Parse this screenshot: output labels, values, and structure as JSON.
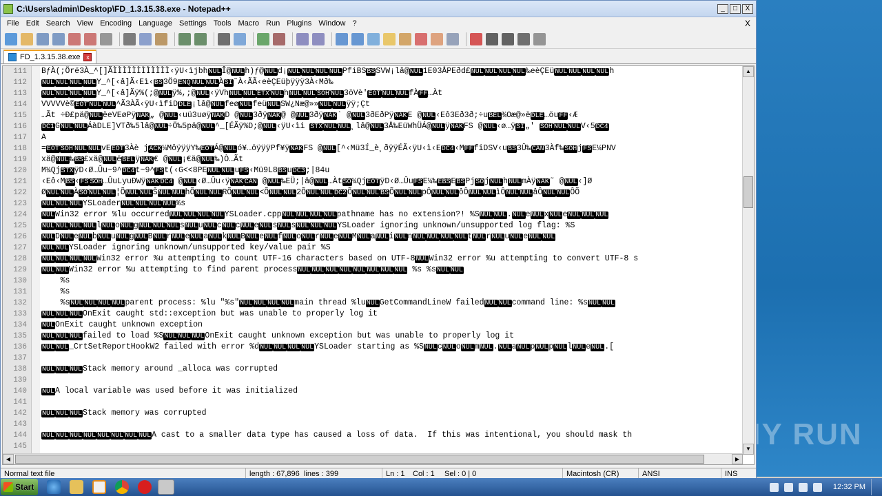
{
  "window": {
    "title": "C:\\Users\\admin\\Desktop\\FD_1.3.15.38.exe - Notepad++",
    "min_label": "_",
    "max_label": "□",
    "close_label": "X"
  },
  "menu": {
    "items": [
      "File",
      "Edit",
      "Search",
      "View",
      "Encoding",
      "Language",
      "Settings",
      "Tools",
      "Macro",
      "Run",
      "Plugins",
      "Window",
      "?"
    ],
    "close_doc": "X"
  },
  "toolbar": {
    "icons": [
      "new-file-icon",
      "open-file-icon",
      "save-icon",
      "save-all-icon",
      "close-icon",
      "close-all-icon",
      "print-icon",
      "cut-icon",
      "copy-icon",
      "paste-icon",
      "undo-icon",
      "redo-icon",
      "find-icon",
      "replace-icon",
      "zoom-in-icon",
      "zoom-out-icon",
      "sync-v-icon",
      "sync-h-icon",
      "word-wrap-icon",
      "show-all-chars-icon",
      "indent-guide-icon",
      "user-lang-icon",
      "doc-map-icon",
      "function-list-icon",
      "folder-as-workspace-icon",
      "monitor-icon",
      "record-macro-icon",
      "stop-record-icon",
      "play-macro-icon",
      "play-multiple-icon",
      "save-macro-icon"
    ]
  },
  "tab": {
    "label": "FD_1.3.15.38.exe",
    "close": "x"
  },
  "editor": {
    "lines": [
      {
        "n": "111",
        "t": "BƒÀ(;Örë3À_^[]ÃÌÌÌÌÌÌÌÌÌÌÌÌ‹ÿU‹ìjbh[NUL]Î@[NUL]h)ƒ@[NUL]d¡[NUL][NUL][NUL][NUL]PfiBS[BS]SVW¡lâ@[NUL]1E03ÅPEðd£[NUL][NUL][NUL][NUL]‰eèÇEü[NUL][NUL][NUL][NUL]h"
      },
      {
        "n": "112",
        "t": "[NUL][NUL][NUL][NUL]Y_^[‹å]Ã‹Eì‹[BS]3Ö9[ENQ][NUL][NUL]À[SI]˜À‹ÃÃ‹eèÇEüþÿÿÿ3À‹Mð‰"
      },
      {
        "n": "113",
        "t": "[NUL][NUL][NUL][NUL]Y_^[‹å]Ãÿ%(;@[NUL]ÿ%,;@[NUL]‹ÿVh[NUL][NUL][ETX][NUL]h[NUL][NUL][SOH][NUL]3öVè'[EOT][NUL][NUL]fÀ[FF]…Àt"
      },
      {
        "n": "114",
        "t": "VVVVVè©[EOT][NUL][NUL]^Ã3ÀÃ‹ÿU‹ìfiD[DLE]¡lâ@[NUL]feø[NUL]feü[NUL]SW¿Næ@»»[NUL][NUL]ÿÿ;Çt"
      },
      {
        "n": "115",
        "t": "…Ãt ÷Ð£pä@[NUL]ëeVEøPÿ[NAK]„ @[NUL]‹uü3uøÿ[NAK]D @[NUL]3ðÿ[NAK]@ @[NUL]3ðÿ[NAK]` @[NUL]3ðEðPÿ[NAK]E @[NUL]‹Eô3Eð3ð;÷u[BEL]¾Oæ@»ë[DLE]…öu[FF]‹Æ"
      },
      {
        "n": "116",
        "t": "[DC1]G[NUL][NUL]ÁàDLE]VTð‰5lâ@[NUL]÷Ö‰5pä@[NUL]^_[ÉÃÿ%D;@[NUL]‹ÿU‹ìi [STX][NUL][NUL]¸lâ@[NUL]3Å‰EüWhÜÁ@[NUL]ÿ[NAK]FS @[NUL]‹ø…ÿ[SI]„' [SOH][NUL][NUL]V‹5[DC4]"
      },
      {
        "n": "117",
        "t": "A"
      },
      {
        "n": "118",
        "t": "=[EOT][SOH][NUL][NUL]vE[EOT]3Àè j[ACK]¼MôÿÿÿY‰[EOT]Á@[NUL]ó¥…öÿÿÿPf¥ÿ[NAK]FS @[NUL][^‹Mü3Í_è¸ðÿÿÉÃ‹ÿU‹ì‹E[DC4]‹M[FF]fiDSV‹u[BS]3Û‰[CAN]3Àf‰[SOH]j[FS]E¼PNV"
      },
      {
        "n": "119",
        "t": "xä@[NUL]‰[BS]£xä@[NUL]ë[BEL]ÿ[NAK]€ @[NUL]¡€ä@[NUL]‰)Ò…Ãt"
      },
      {
        "n": "120",
        "t": "M¼Qj[STX]ÿD‹Ø…Ûu~9^[DC4]t~9^[FS]t(‹G<<8PE[NUL][NUL]u[FS]‹Mü9L8[BS]u[DC3];|84u"
      },
      {
        "n": "121",
        "t": "‹Eô‹M[BS]‹[FS][SOH]…ÛuLyuÐWÿ[NAK][DC4] @[NUL]‹Ø…Ûu‹ÿ[NAK][CAN] @[NUL]‰EÜ;|ä@[NUL]…Àt[SO]¼Qj[EOT]ÿD‹Ø…Ûu[FS]E¼‰[EBS]E[BS]Pj[SO]j[NUL]h[NUL]mÀÿ[NAK]˜ @[NUL]‹]Ø"
      },
      {
        "n": "122",
        "t": "Ø[NUL][NUL]À[SO][NUL][NUL]¦Õ[NUL][NUL]Š[NUL][NUL]hÕ[NUL][NUL]RÕ[NUL][NUL]<Õ[NUL][NUL]2Õ[NUL][NUL][DC2]Õ[NUL][NUL][BS]Õ[NUL][NUL]pÔ[NUL][NUL]ôÔ[NUL][NUL]ìÔ[NUL][NUL]âÔ[NUL][NUL]ÔÕ"
      },
      {
        "n": "123",
        "t": "[NUL][NUL][NUL]YSLoader[NUL][NUL][NUL][NUL]%s"
      },
      {
        "n": "124",
        "t": "[NUL]Win32 error %lu occurred[NUL][NUL][NUL][NUL]YSLoader.cpp[NUL][NUL][NUL][NUL]pathname has no extension?! %S[NUL][NUL].[NUL]e[NUL]x[NUL]e[NUL][NUL][NUL]"
      },
      {
        "n": "125",
        "t": "[NUL][NUL][NUL][NUL]l[NUL]o[NUL]g[NUL][NUL][NUL]s[NUL]u[NUL]c[NUL]c[NUL]e[NUL]s[NUL]s[NUL][NUL][NUL]YSLoader ignoring unknown/unsupported log flag: %S"
      },
      {
        "n": "126",
        "t": "[NUL]D[NUL]e[NUL]b[NUL]u[NUL]g[NUL]B[NUL]r[NUL]e[NUL]a[NUL]k[NUL]B[NUL]e[NUL]f[NUL]o[NUL]r[NUL]e[NUL]M[NUL]a[NUL]i[NUL]n[NUL][NUL][NUL][NUL]t[NUL]r[NUL]u[NUL]e[NUL][NUL]"
      },
      {
        "n": "127",
        "t": "[NUL][NUL]YSLoader ignoring unknown/unsupported key/value pair %S"
      },
      {
        "n": "128",
        "t": "[NUL][NUL][NUL][NUL]Win32 error %u attempting to count UTF-16 characters based on UTF-8[NUL]Win32 error %u attempting to convert UTF-8 s"
      },
      {
        "n": "129",
        "t": "[NUL][NUL]Win32 error %u attempting to find parent process[NUL][NUL][NUL][NUL][NUL][NUL][NUL][NUL] %s %s[NUL][NUL]"
      },
      {
        "n": "130",
        "t": "    %s"
      },
      {
        "n": "131",
        "t": "    %s"
      },
      {
        "n": "132",
        "t": "    %s[NUL][NUL][NUL][NUL]parent process: %lu \"%s\"[NUL][NUL][NUL][NUL]main thread %lu[NUL]GetCommandLineW failed[NUL][NUL]command line: %s[NUL][NUL]"
      },
      {
        "n": "133",
        "t": "[NUL][NUL][NUL]OnExit caught std::exception but was unable to properly log it"
      },
      {
        "n": "134",
        "t": "[NUL]OnExit caught unknown exception"
      },
      {
        "n": "135",
        "t": "[NUL][NUL][NUL]failed to load %S[NUL][NUL][NUL]OnExit caught unknown exception but was unable to properly log it"
      },
      {
        "n": "136",
        "t": "[NUL][NUL]_CrtSetReportHookW2 failed with error %d[NUL][NUL][NUL][NUL]YSLoader starting as %S[NUL]c[NUL]o[NUL]m[NUL].[NUL]a[NUL]p[NUL]p[NUL]l[NUL]e[NUL].["
      },
      {
        "n": "137",
        "t": ""
      },
      {
        "n": "138",
        "t": "[NUL][NUL][NUL]Stack memory around _alloca was corrupted"
      },
      {
        "n": "139",
        "t": ""
      },
      {
        "n": "140",
        "t": "[NUL]A local variable was used before it was initialized"
      },
      {
        "n": "141",
        "t": ""
      },
      {
        "n": "142",
        "t": "[NUL][NUL][NUL]Stack memory was corrupted"
      },
      {
        "n": "143",
        "t": ""
      },
      {
        "n": "144",
        "t": "[NUL][NUL][NUL][NUL][NUL][NUL][NUL][NUL]A cast to a smaller data type has caused a loss of data.  If this was intentional, you should mask th"
      },
      {
        "n": "145",
        "t": ""
      }
    ]
  },
  "status": {
    "type": "Normal text file",
    "length": "length : 67,896",
    "lines": "lines : 399",
    "ln": "Ln : 1",
    "col": "Col : 1",
    "sel": "Sel : 0 | 0",
    "eol": "Macintosh (CR)",
    "encoding": "ANSI",
    "mode": "INS"
  },
  "taskbar": {
    "start": "Start",
    "clock": "12:32 PM",
    "apps": [
      "ie-icon",
      "explorer-icon",
      "media-player-icon",
      "chrome-icon",
      "opera-icon",
      "notepadpp-icon"
    ]
  },
  "watermark": "ANY RUN",
  "colors": {
    "token_bg": "#000000",
    "tab_accent": "#f0a020",
    "taskbar": "#24528f"
  }
}
